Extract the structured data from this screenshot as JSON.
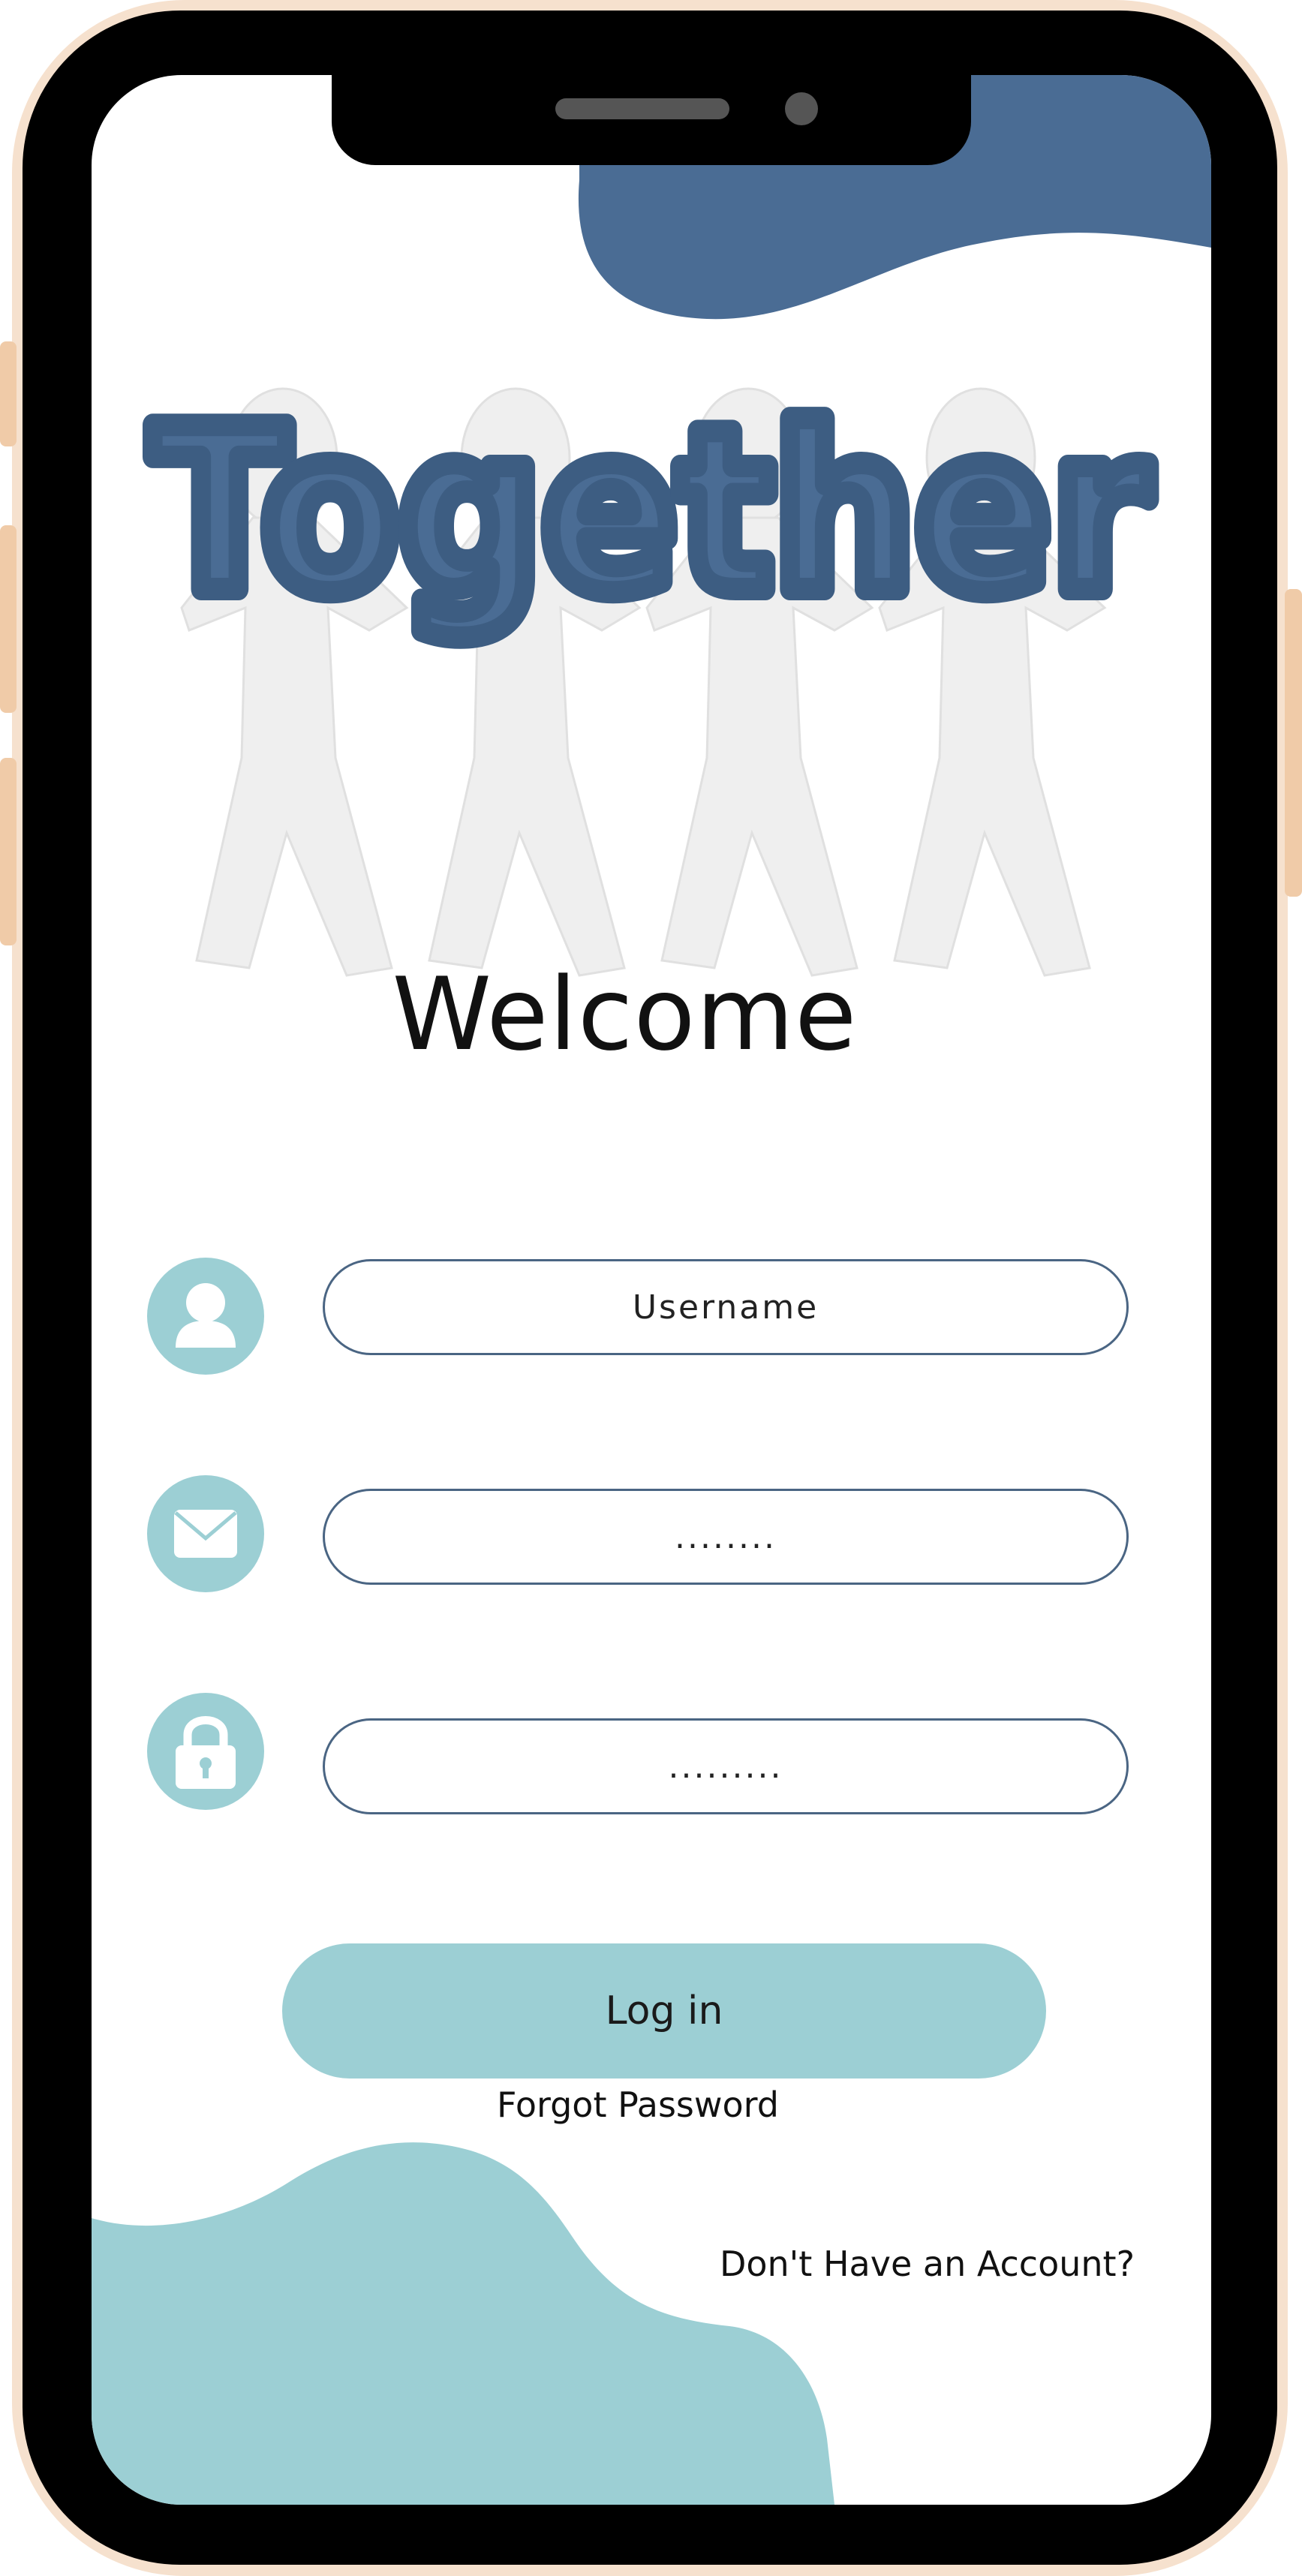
{
  "app": {
    "logo_text": "Together"
  },
  "welcome": {
    "title": "Welcome"
  },
  "form": {
    "username": {
      "placeholder": "Username",
      "icon": "user-icon"
    },
    "email": {
      "value": "........",
      "icon": "mail-icon"
    },
    "password": {
      "value": ".........",
      "icon": "lock-icon"
    }
  },
  "actions": {
    "login_label": "Log in",
    "forgot_label": "Forgot Password",
    "signup_label": "Don't Have an Account?"
  },
  "colors": {
    "primary_blue": "#4a6c94",
    "accent_teal": "#9ccfd4",
    "frame_peach": "#f6e1ce"
  }
}
